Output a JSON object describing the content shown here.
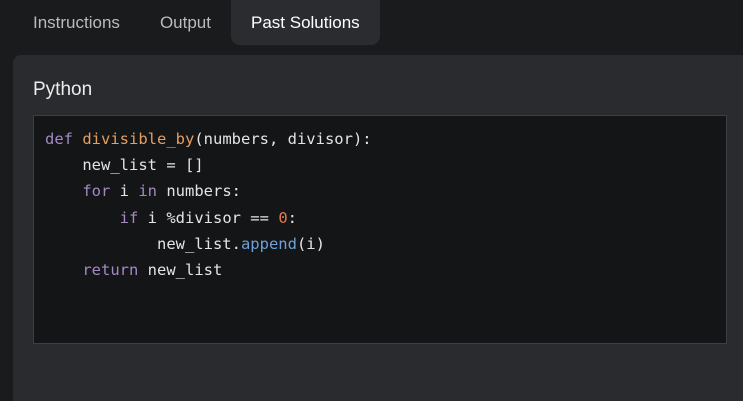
{
  "tabs": [
    {
      "label": "Instructions",
      "active": false
    },
    {
      "label": "Output",
      "active": false
    },
    {
      "label": "Past Solutions",
      "active": true
    }
  ],
  "panel": {
    "language": "Python"
  },
  "code": {
    "lines": [
      [
        {
          "t": "kw",
          "v": "def"
        },
        {
          "t": "plain",
          "v": " "
        },
        {
          "t": "fn",
          "v": "divisible_by"
        },
        {
          "t": "plain",
          "v": "(numbers, divisor):"
        }
      ],
      [
        {
          "t": "plain",
          "v": "    new_list = []"
        }
      ],
      [
        {
          "t": "plain",
          "v": "    "
        },
        {
          "t": "kw",
          "v": "for"
        },
        {
          "t": "plain",
          "v": " i "
        },
        {
          "t": "kw",
          "v": "in"
        },
        {
          "t": "plain",
          "v": " numbers:"
        }
      ],
      [
        {
          "t": "plain",
          "v": "        "
        },
        {
          "t": "kw",
          "v": "if"
        },
        {
          "t": "plain",
          "v": " i %divisor == "
        },
        {
          "t": "num",
          "v": "0"
        },
        {
          "t": "plain",
          "v": ":"
        }
      ],
      [
        {
          "t": "plain",
          "v": "            new_list."
        },
        {
          "t": "meth",
          "v": "append"
        },
        {
          "t": "plain",
          "v": "(i)"
        }
      ],
      [
        {
          "t": "plain",
          "v": "    "
        },
        {
          "t": "kw",
          "v": "return"
        },
        {
          "t": "plain",
          "v": " new_list"
        }
      ]
    ]
  },
  "colors": {
    "background": "#1a1b1d",
    "panel": "#292b2e",
    "code_background": "#141516",
    "keyword": "#a688c5",
    "function": "#e59e60",
    "number": "#e07b4f",
    "method": "#6da1d8"
  }
}
